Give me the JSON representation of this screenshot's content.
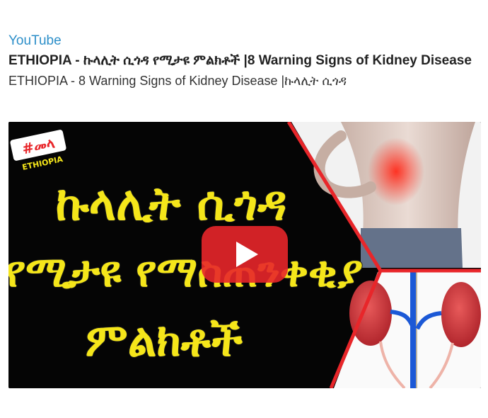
{
  "embed": {
    "source_label": "YouTube",
    "title": "ETHIOPIA - ኩላሊት ሲጎዳ የሚታዩ ምልክቶች  |8 Warning Signs of Kidney Disease",
    "description": "ETHIOPIA - 8 Warning Signs of Kidney Disease |ኩላሊት ሲጎዳ"
  },
  "thumbnail": {
    "badge_text": "#መላ",
    "badge_subtext": "ETHIOPIA",
    "headline_line1": "ኩላሊት ሲጎዳ",
    "headline_line2": "የሚታዩ የማስጠንቀቂያ",
    "headline_line3": "ምልክቶች",
    "headline_color": "#f5e61a",
    "accent_red": "#e8262a"
  },
  "player": {
    "play_icon": "play-icon",
    "play_color": "#e8262a"
  }
}
